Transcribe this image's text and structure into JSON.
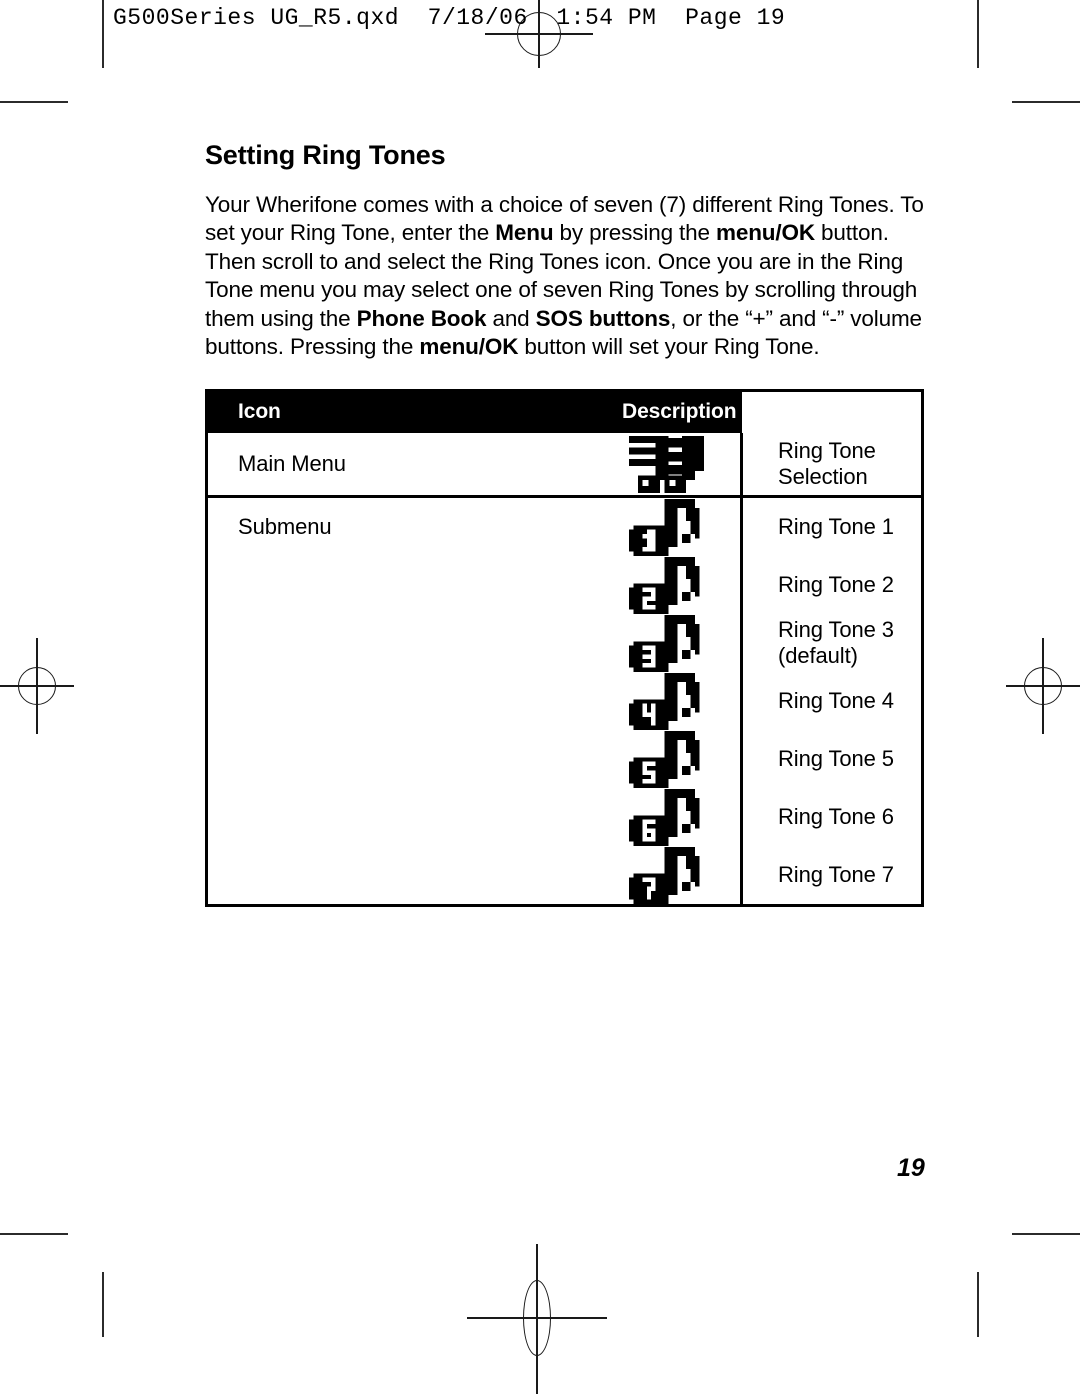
{
  "header": {
    "running_header": "G500Series UG_R5.qxd  7/18/06  1:54 PM  Page 19"
  },
  "section": {
    "title": "Setting Ring Tones",
    "paragraph_parts": [
      {
        "text": "Your Wherifone comes with a choice of seven (7) different Ring Tones. To set your Ring Tone, enter the ",
        "bold": false
      },
      {
        "text": "Menu",
        "bold": true
      },
      {
        "text": " by pressing the ",
        "bold": false
      },
      {
        "text": "menu/OK",
        "bold": true
      },
      {
        "text": " button. Then scroll to and select the Ring Tones icon. Once you are in the Ring Tone menu you may select one of seven Ring Tones by scrolling through them using the ",
        "bold": false
      },
      {
        "text": "Phone Book",
        "bold": true
      },
      {
        "text": " and ",
        "bold": false
      },
      {
        "text": "SOS buttons",
        "bold": true
      },
      {
        "text": ", or the “+” and “-” volume buttons. Pressing the ",
        "bold": false
      },
      {
        "text": "menu/OK",
        "bold": true
      },
      {
        "text": " button will set your Ring Tone.",
        "bold": false
      }
    ]
  },
  "table": {
    "columns": [
      "Icon",
      "Description"
    ],
    "rows": [
      {
        "label": "Main Menu",
        "icon": "double-music-note-icon",
        "icon_number": "",
        "description": "Ring Tone Selection"
      },
      {
        "label": "Submenu",
        "icon": "music-note-1-icon",
        "icon_number": "1",
        "description": "Ring Tone 1"
      },
      {
        "label": "",
        "icon": "music-note-2-icon",
        "icon_number": "2",
        "description": "Ring Tone 2"
      },
      {
        "label": "",
        "icon": "music-note-3-icon",
        "icon_number": "3",
        "description": "Ring Tone 3 (default)"
      },
      {
        "label": "",
        "icon": "music-note-4-icon",
        "icon_number": "4",
        "description": "Ring Tone 4"
      },
      {
        "label": "",
        "icon": "music-note-5-icon",
        "icon_number": "5",
        "description": "Ring Tone 5"
      },
      {
        "label": "",
        "icon": "music-note-6-icon",
        "icon_number": "6",
        "description": "Ring Tone 6"
      },
      {
        "label": "",
        "icon": "music-note-7-icon",
        "icon_number": "7",
        "description": "Ring Tone 7"
      }
    ]
  },
  "footer": {
    "page_number": "19"
  },
  "colors": {
    "ink": "#000000",
    "paper": "#ffffff",
    "header_band": "#000000",
    "header_band_text": "#ffffff",
    "crop_mark": "#2b2b2b"
  }
}
